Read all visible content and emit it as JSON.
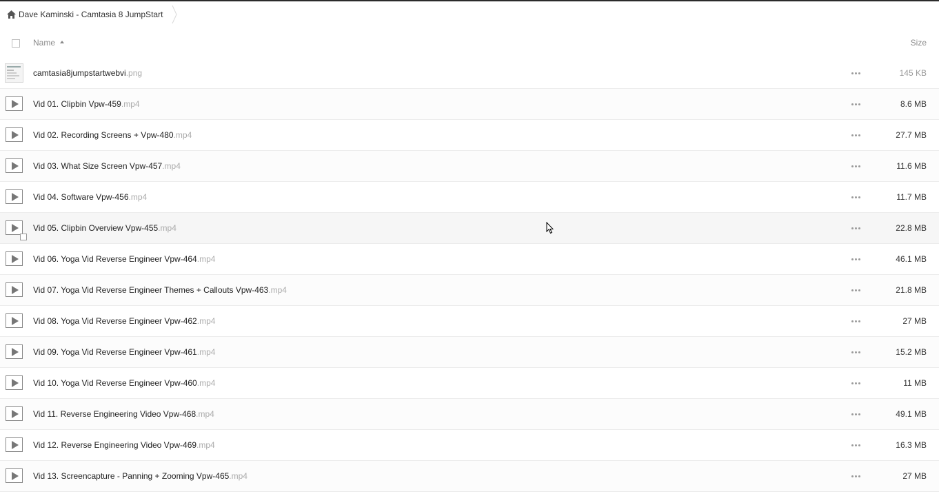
{
  "breadcrumb": {
    "title": "Dave Kaminski - Camtasia 8 JumpStart"
  },
  "header": {
    "name_label": "Name",
    "size_label": "Size"
  },
  "files": [
    {
      "name": "camtasia8jumpstartwebvi",
      "ext": ".png",
      "size": "145 KB",
      "type": "image"
    },
    {
      "name": "Vid 01. Clipbin Vpw-459",
      "ext": ".mp4",
      "size": "8.6 MB",
      "type": "video"
    },
    {
      "name": "Vid 02. Recording Screens + Vpw-480",
      "ext": ".mp4",
      "size": "27.7 MB",
      "type": "video"
    },
    {
      "name": "Vid 03. What Size Screen Vpw-457",
      "ext": ".mp4",
      "size": "11.6 MB",
      "type": "video"
    },
    {
      "name": "Vid 04. Software Vpw-456",
      "ext": ".mp4",
      "size": "11.7 MB",
      "type": "video"
    },
    {
      "name": "Vid 05. Clipbin Overview Vpw-455",
      "ext": ".mp4",
      "size": "22.8 MB",
      "type": "video",
      "hovered": true
    },
    {
      "name": "Vid 06. Yoga Vid Reverse Engineer Vpw-464",
      "ext": ".mp4",
      "size": "46.1 MB",
      "type": "video"
    },
    {
      "name": "Vid 07. Yoga Vid Reverse Engineer Themes + Callouts Vpw-463",
      "ext": ".mp4",
      "size": "21.8 MB",
      "type": "video"
    },
    {
      "name": "Vid 08. Yoga Vid Reverse Engineer Vpw-462",
      "ext": ".mp4",
      "size": "27 MB",
      "type": "video"
    },
    {
      "name": "Vid 09. Yoga Vid Reverse Engineer Vpw-461",
      "ext": ".mp4",
      "size": "15.2 MB",
      "type": "video"
    },
    {
      "name": "Vid 10. Yoga Vid Reverse Engineer Vpw-460",
      "ext": ".mp4",
      "size": "11 MB",
      "type": "video"
    },
    {
      "name": "Vid 11. Reverse Engineering Video Vpw-468",
      "ext": ".mp4",
      "size": "49.1 MB",
      "type": "video"
    },
    {
      "name": "Vid 12. Reverse Engineering Video Vpw-469",
      "ext": ".mp4",
      "size": "16.3 MB",
      "type": "video"
    },
    {
      "name": "Vid 13. Screencapture - Panning + Zooming Vpw-465",
      "ext": ".mp4",
      "size": "27 MB",
      "type": "video"
    }
  ],
  "icons": {
    "home": "home-icon",
    "sort": "sort-ascending-icon",
    "more": "more-options-icon",
    "video": "video-file-icon",
    "image": "image-thumbnail-icon"
  }
}
